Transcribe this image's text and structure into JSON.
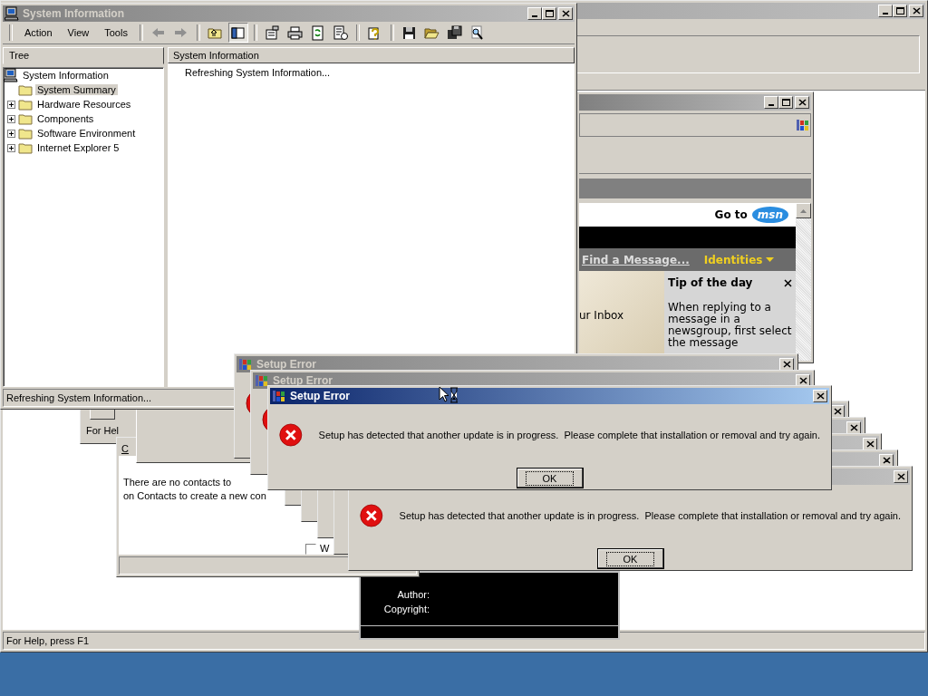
{
  "background_window": {
    "status_text": "For Help, press F1"
  },
  "system_information": {
    "title": "System Information",
    "menu": [
      "Action",
      "View",
      "Tools"
    ],
    "tabs": [
      {
        "label": "Tree",
        "selected": true
      }
    ],
    "tree": {
      "label": "System Information",
      "children": [
        {
          "label": "System Summary",
          "kind": "leaf",
          "selected": true
        },
        {
          "label": "Hardware Resources",
          "kind": "collapsed",
          "selected": false
        },
        {
          "label": "Components",
          "kind": "collapsed",
          "selected": false
        },
        {
          "label": "Software Environment",
          "kind": "collapsed",
          "selected": false
        },
        {
          "label": "Internet Explorer 5",
          "kind": "collapsed",
          "selected": false
        }
      ]
    },
    "column_header": "System Information",
    "message": "Refreshing System Information...",
    "status_text": "Refreshing System Information..."
  },
  "outlook_window": {
    "go_to": "Go to",
    "logo_text": "msn",
    "find_link": "Find a Message...",
    "identities": "Identities",
    "photo_caption": "ur Inbox",
    "tip_title": "Tip of the day",
    "tip_text": "When replying to a message in a newsgroup, first select the message"
  },
  "help_window": {
    "status_fragment": "For Hel"
  },
  "address_book": {
    "tab_fragment": "C",
    "contacts_lines": [
      "There are no contacts to",
      "on Contacts to create a new con"
    ],
    "checkbox": {
      "label": "W",
      "checked": false
    }
  },
  "properties_panel": {
    "labels": [
      "Author:",
      "Copyright:"
    ]
  },
  "dialogs": [
    {
      "kind": "frame",
      "active": false
    },
    {
      "kind": "frame",
      "active": false
    },
    {
      "kind": "frame",
      "active": false
    },
    {
      "kind": "frame",
      "active": false
    },
    {
      "kind": "body",
      "active": false,
      "message": "Setup has detected that another update is in progress.  Please complete that installation or removal and try again.",
      "button": "OK"
    },
    {
      "kind": "title",
      "active": false,
      "title": "Setup Error"
    },
    {
      "kind": "title",
      "active": false,
      "title": "Setup Error"
    },
    {
      "kind": "full",
      "active": true,
      "title": "Setup Error",
      "message": "Setup has detected that another update is in progress.  Please complete that installation or removal and try again.",
      "button": "OK"
    }
  ]
}
